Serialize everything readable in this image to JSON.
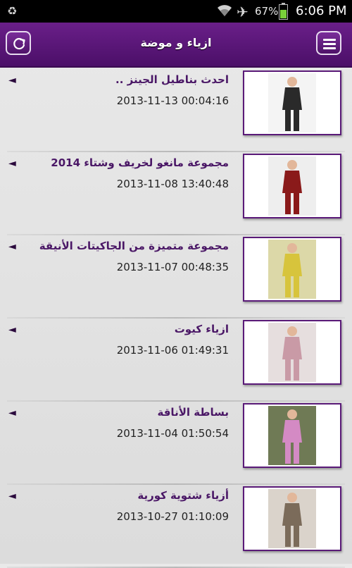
{
  "status_bar": {
    "battery_text": "67%",
    "time": "6:06 PM",
    "battery_level": 0.67,
    "icons": [
      "recycle-icon",
      "wifi-icon",
      "airplane-icon",
      "battery-icon"
    ]
  },
  "app_bar": {
    "title": "ازياء و موضة",
    "left_button_icon": "refresh-icon",
    "right_button_icon": "menu-icon",
    "accent_color": "#5a1a78"
  },
  "articles": [
    {
      "title": "احدث بناطيل الجينز ..",
      "date": "2013-11-13 00:04:16",
      "thumb_color": "#2a2a2a",
      "thumb_bg": "#f4f4f4"
    },
    {
      "title": "مجموعة مانغو لخريف وشتاء 2014",
      "date": "2013-11-08 13:40:48",
      "thumb_color": "#8a1a1a",
      "thumb_bg": "#eeeeee"
    },
    {
      "title": "مجموعة متميزة من الجاكيتات الأنيقة",
      "date": "2013-11-07 00:48:35",
      "thumb_color": "#d7c43c",
      "thumb_bg": "#dcd8a8"
    },
    {
      "title": "ازياء كيوت",
      "date": "2013-11-06 01:49:31",
      "thumb_color": "#c99aa6",
      "thumb_bg": "#e6dede"
    },
    {
      "title": "بساطة الأناقة",
      "date": "2013-11-04 01:50:54",
      "thumb_color": "#d48ac4",
      "thumb_bg": "#6f7a55"
    },
    {
      "title": "أزياء شتوية كورية",
      "date": "2013-10-27 01:10:09",
      "thumb_color": "#7b6b5a",
      "thumb_bg": "#dad3cb"
    }
  ]
}
